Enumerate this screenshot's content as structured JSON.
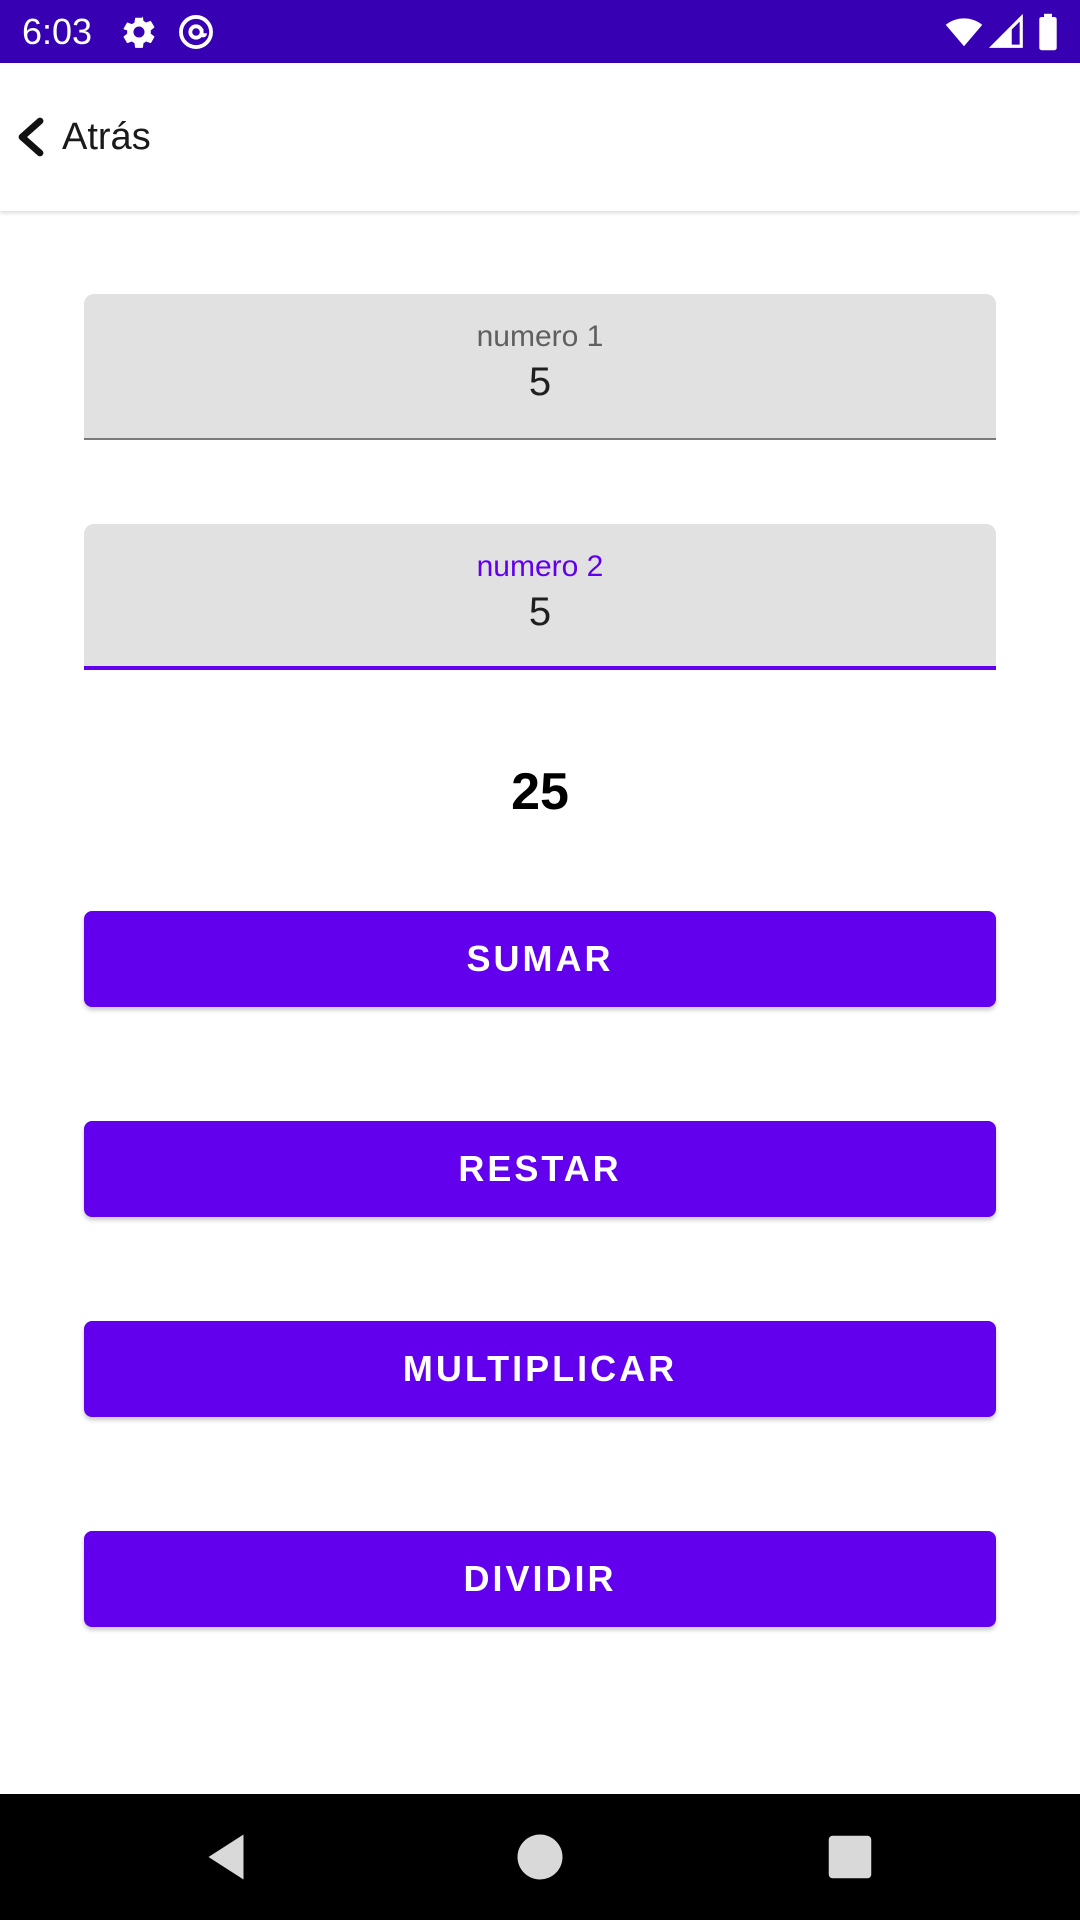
{
  "status_bar": {
    "time": "6:03",
    "background": "#3700b3",
    "left_icons": [
      "settings-gear-icon",
      "at-sign-icon"
    ],
    "right_icons": [
      "wifi-icon",
      "cell-signal-icon",
      "battery-icon"
    ]
  },
  "app_bar": {
    "back_label": "Atrás",
    "back_icon": "chevron-left-icon"
  },
  "fields": [
    {
      "label": "numero 1",
      "value": "5",
      "focused": false
    },
    {
      "label": "numero 2",
      "value": "5",
      "focused": true
    }
  ],
  "result": "25",
  "buttons": {
    "sumar": "SUMAR",
    "restar": "RESTAR",
    "multiplicar": "MULTIPLICAR",
    "dividir": "DIVIDIR"
  },
  "nav_bar": {
    "icons": [
      "back-triangle-icon",
      "home-circle-icon",
      "recents-square-icon"
    ]
  },
  "colors": {
    "accent": "#6200ee",
    "status_bar": "#3700b3",
    "field_background": "#e1e1e1"
  }
}
